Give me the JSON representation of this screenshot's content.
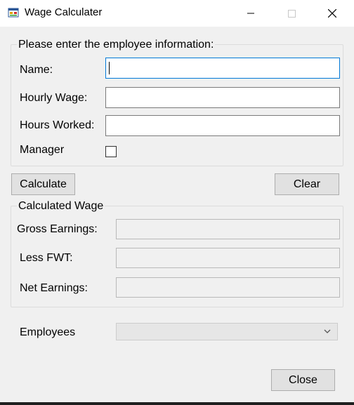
{
  "window": {
    "title": "Wage Calculater",
    "icon": "winforms-app-icon",
    "controls": [
      "minimize-icon",
      "maximize-icon",
      "close-icon"
    ]
  },
  "employee_info": {
    "legend": "Please enter the employee information:",
    "name_label": "Name:",
    "name_value": "",
    "hourly_wage_label": "Hourly Wage:",
    "hourly_wage_value": "",
    "hours_worked_label": "Hours Worked:",
    "hours_worked_value": "",
    "manager_label": "Manager",
    "manager_checked": false
  },
  "buttons": {
    "calculate": "Calculate",
    "clear": "Clear",
    "close": "Close"
  },
  "calculated_wage": {
    "legend": "Calculated Wage",
    "gross_label": "Gross Earnings:",
    "gross_value": "",
    "fwt_label": "Less FWT:",
    "fwt_value": "",
    "net_label": "Net Earnings:",
    "net_value": ""
  },
  "employees": {
    "label": "Employees",
    "selected": ""
  },
  "colors": {
    "window_bg": "#f0f0f0",
    "focus_border": "#0078d7",
    "button_bg": "#e1e1e1"
  }
}
